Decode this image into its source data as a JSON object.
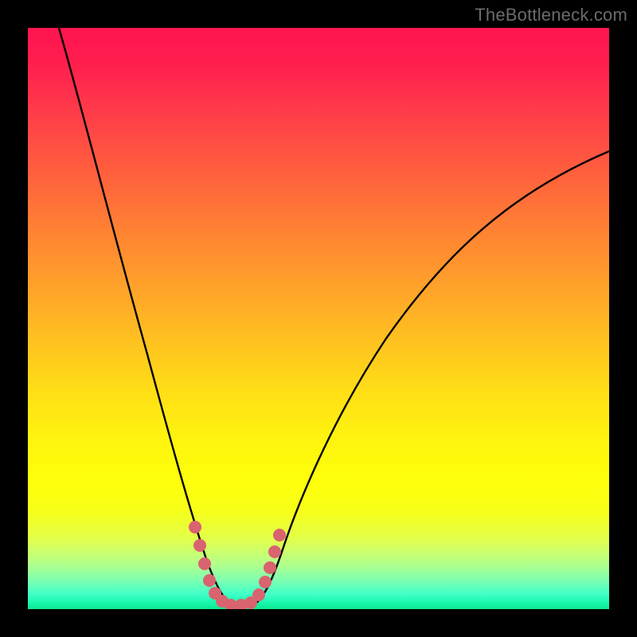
{
  "watermark": "TheBottleneck.com",
  "colors": {
    "background": "#000000",
    "curve": "#000000",
    "marker": "#d9636f",
    "gradient_top": "#ff1450",
    "gradient_bottom": "#0ee790"
  },
  "chart_data": {
    "type": "line",
    "title": "",
    "xlabel": "",
    "ylabel": "",
    "xlim": [
      0,
      100
    ],
    "ylim": [
      0,
      100
    ],
    "grid": false,
    "legend": false,
    "annotations": [
      "TheBottleneck.com"
    ],
    "note": "Axes are implicit (no tick labels shown). Curve values are estimated from pixel positions; y is a percentage-like metric where 0 is at the bottom (green) and 100 at the top (red). The curve reaches ~0 around x≈33–38.",
    "series": [
      {
        "name": "bottleneck-curve",
        "x": [
          5,
          10,
          15,
          20,
          25,
          28,
          30,
          32,
          33,
          34,
          35,
          36,
          37,
          38,
          40,
          42,
          45,
          50,
          55,
          60,
          70,
          80,
          90,
          100
        ],
        "y": [
          100,
          83,
          66,
          48,
          29,
          17,
          10,
          4,
          1,
          0,
          0,
          0,
          0,
          1,
          4,
          9,
          15,
          25,
          33,
          40,
          52,
          61,
          68,
          74
        ]
      }
    ],
    "markers": {
      "name": "min-region-markers",
      "x": [
        28,
        29,
        30.5,
        32,
        33,
        34,
        35.5,
        37,
        38,
        38.8,
        39.5,
        40,
        40.5
      ],
      "y": [
        14,
        10,
        5,
        2,
        0.5,
        0,
        0,
        0.5,
        2,
        4,
        7,
        10,
        14
      ]
    }
  }
}
